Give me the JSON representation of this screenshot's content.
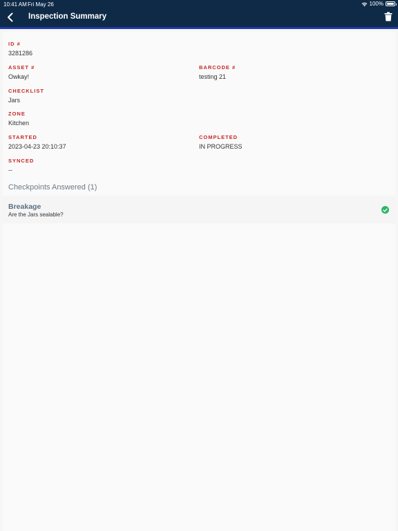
{
  "status_bar": {
    "time": "10:41 AM",
    "date": "Fri May 26",
    "battery": "100%"
  },
  "header": {
    "title": "Inspection Summary",
    "back_icon": "chevron-left-icon",
    "delete_icon": "trash-icon"
  },
  "fields": {
    "id": {
      "label": "ID #",
      "value": "3281286"
    },
    "asset": {
      "label": "ASSET #",
      "value": "Owkay!"
    },
    "barcode": {
      "label": "BARCODE #",
      "value": "testing 21"
    },
    "checklist": {
      "label": "CHECKLIST",
      "value": "Jars"
    },
    "zone": {
      "label": "ZONE",
      "value": "Kitchen"
    },
    "started": {
      "label": "STARTED",
      "value": "2023-04-23 20:10:37"
    },
    "completed": {
      "label": "COMPLETED",
      "value": "IN PROGRESS"
    },
    "synced": {
      "label": "SYNCED",
      "value": "--"
    }
  },
  "checkpoints": {
    "heading": "Checkpoints Answered (1)",
    "items": [
      {
        "title": "Breakage",
        "question": "Are the Jars sealable?",
        "status_icon": "check-circle-icon"
      }
    ]
  },
  "colors": {
    "header_bg": "#0e2a47",
    "header_accent": "#1f3aa8",
    "label_red": "#c62828",
    "check_green": "#2fb56a"
  }
}
